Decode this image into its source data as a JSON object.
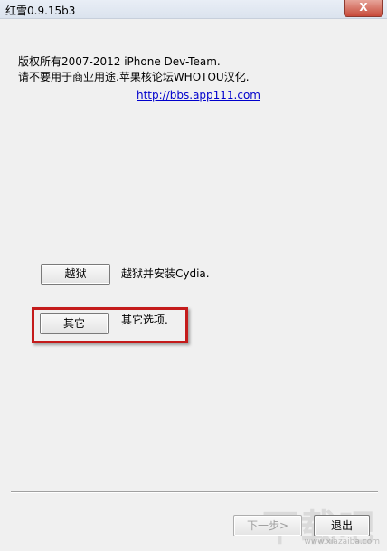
{
  "window": {
    "title": "红雪0.9.15b3",
    "close_label": "X"
  },
  "info": {
    "copyright_line1": "版权所有2007-2012 iPhone Dev-Team.",
    "copyright_line2": "请不要用于商业用途.苹果核论坛WHOTOU汉化.",
    "link": "http://bbs.app111.com"
  },
  "actions": {
    "jailbreak_button": "越狱",
    "jailbreak_desc": "越狱并安装Cydia.",
    "other_button": "其它",
    "other_desc": "其它选项."
  },
  "footer": {
    "next_button": "下一步>",
    "exit_button": "退出"
  },
  "watermark": {
    "text": "下载吧",
    "sub": "www.xiazaiba.com"
  },
  "colors": {
    "highlight": "#c41b1b",
    "link": "#0000cc"
  }
}
